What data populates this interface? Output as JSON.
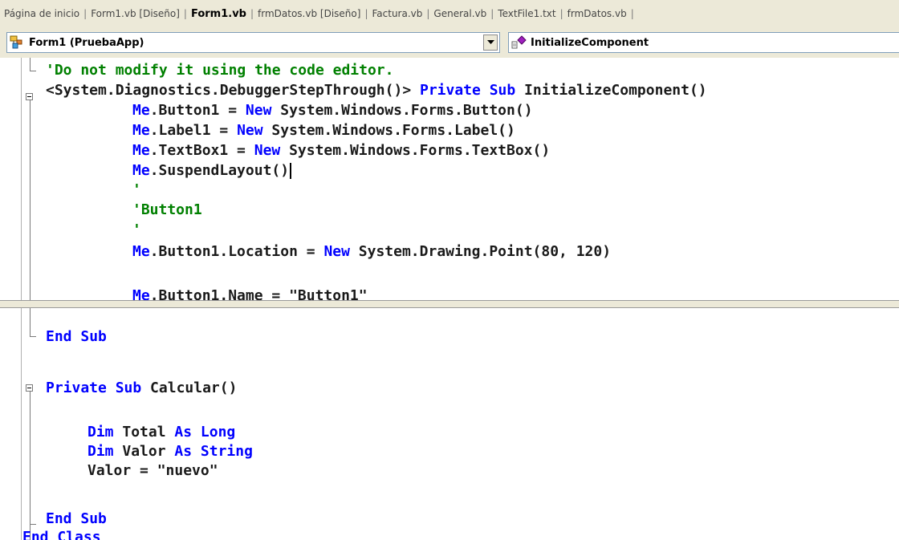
{
  "tabs": [
    {
      "label": "Página de inicio",
      "active": false
    },
    {
      "label": "Form1.vb [Diseño]",
      "active": false
    },
    {
      "label": "Form1.vb",
      "active": true
    },
    {
      "label": "frmDatos.vb [Diseño]",
      "active": false
    },
    {
      "label": "Factura.vb",
      "active": false
    },
    {
      "label": "General.vb",
      "active": false
    },
    {
      "label": "TextFile1.txt",
      "active": false
    },
    {
      "label": "frmDatos.vb",
      "active": false
    }
  ],
  "class_dropdown": {
    "value": "Form1 (PruebaApp)",
    "icon": "class-icon"
  },
  "method_dropdown": {
    "value": "InitializeComponent",
    "icon": "method-icon"
  },
  "colors": {
    "keyword": "#0000ff",
    "comment": "#008000",
    "text": "#1a1a1a"
  },
  "top_code": {
    "line1": {
      "comment": "'Do not modify it using the code editor."
    },
    "line2": {
      "t1": "<System.Diagnostics.DebuggerStepThrough()> ",
      "k1": "Private",
      "k2": "Sub",
      "t2": " InitializeComponent()"
    },
    "line3": {
      "k1": "Me",
      "t1": ".Button1 = ",
      "k2": "New",
      "t2": " System.Windows.Forms.Button()"
    },
    "line4": {
      "k1": "Me",
      "t1": ".Label1 = ",
      "k2": "New",
      "t2": " System.Windows.Forms.Label()"
    },
    "line5": {
      "k1": "Me",
      "t1": ".TextBox1 = ",
      "k2": "New",
      "t2": " System.Windows.Forms.TextBox()"
    },
    "line6": {
      "k1": "Me",
      "t1": ".SuspendLayout()"
    },
    "line7": {
      "comment": "'"
    },
    "line8": {
      "comment": "'Button1"
    },
    "line9": {
      "comment": "'"
    },
    "line10": {
      "k1": "Me",
      "t1": ".Button1.Location = ",
      "k2": "New",
      "t2": " System.Drawing.Point(80, 120)"
    },
    "line11": {
      "k1": "Me",
      "t1": ".Button1.Name = \"Button1\""
    }
  },
  "bottom_code": {
    "line1": {
      "k1": "End",
      "k2": "Sub"
    },
    "line2": {
      "k1": "Private",
      "k2": "Sub",
      "t1": " Calcular()"
    },
    "line3": {
      "k1": "Dim",
      "t1": " Total ",
      "k2": "As",
      "k3": "Long"
    },
    "line4": {
      "k1": "Dim",
      "t1": " Valor ",
      "k2": "As",
      "k3": "String"
    },
    "line5": {
      "t1": "Valor = \"nuevo\""
    },
    "line6": {
      "k1": "End",
      "k2": "Sub"
    },
    "line7": {
      "k1": "End",
      "k2": "Class"
    }
  }
}
